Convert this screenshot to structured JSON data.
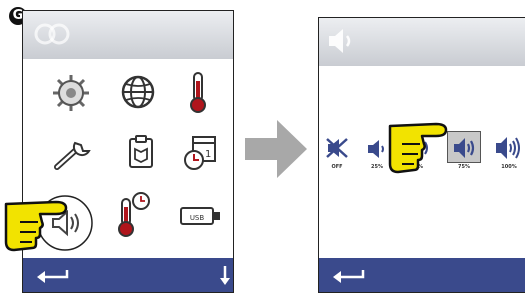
{
  "badge": "G",
  "left_screen": {
    "menu_icons": [
      "settings-gear-icon",
      "globe-icon",
      "thermometer-icon",
      "wrench-icon",
      "clipboard-icon",
      "calendar-clock-icon",
      "speaker-icon",
      "thermometer-clock-icon",
      "usb-icon"
    ],
    "usb_label": "USB"
  },
  "right_screen": {
    "volume_levels": [
      {
        "label": "OFF",
        "selected": false
      },
      {
        "label": "25%",
        "selected": false
      },
      {
        "label": "50%",
        "selected": false
      },
      {
        "label": "75%",
        "selected": true
      },
      {
        "label": "100%",
        "selected": false
      }
    ]
  },
  "colors": {
    "bottom_bar": "#3a4a8c",
    "hand": "#f2e300",
    "icon_blue": "#3a4a8c",
    "thermo_red": "#b0151c",
    "arrow_grey": "#a8a8a8"
  }
}
